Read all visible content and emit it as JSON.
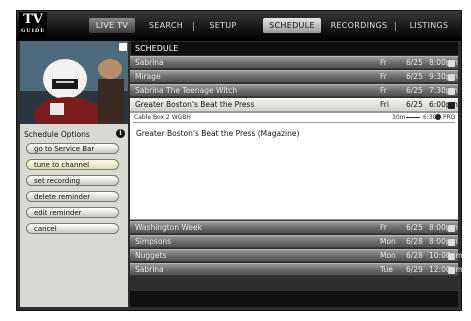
{
  "nav": {
    "live_tv": "LIVE TV",
    "search": "SEARCH",
    "setup": "SETUP",
    "schedule": "SCHEDULE",
    "recordings": "RECORDINGS",
    "listings": "LISTINGS"
  },
  "logo": {
    "main": "TV",
    "sub": "GUIDE"
  },
  "schedule_header": "SCHEDULE",
  "schedule_rows": [
    {
      "title": "Sabrina",
      "day": "Fr",
      "date": "6/25",
      "time": "8:00pm"
    },
    {
      "title": "Mirage",
      "day": "Fr",
      "date": "6/25",
      "time": "9:30pm"
    },
    {
      "title": "Sabrina The Teenage Witch",
      "day": "Fr",
      "date": "6/25",
      "time": "7:30pm"
    }
  ],
  "selected_row": {
    "title": "Greater Boston's Beat the Press",
    "day": "Fri",
    "date": "6/25",
    "time": "6:00pm"
  },
  "detail": {
    "subtitle": "Cable Box 2 WGBH",
    "duration": "30m",
    "end_time": "6:30",
    "rating": "PRO",
    "description": "Greater Boston's Beat the Press (Magazine)"
  },
  "schedule_rows_lower": [
    {
      "title": "Washington Week",
      "day": "Fr",
      "date": "6/25",
      "time": "8:00pm"
    },
    {
      "title": "Simpsons",
      "day": "Mon",
      "date": "6/28",
      "time": "8:00pm"
    },
    {
      "title": "Nuggets",
      "day": "Mon",
      "date": "6/28",
      "time": "10:00pm"
    },
    {
      "title": "Sabrina",
      "day": "Tue",
      "date": "6/29",
      "time": "12:00pm"
    }
  ],
  "options": {
    "title": "Schedule Options",
    "items": [
      "go to Service Bar",
      "tune to channel",
      "set recording",
      "delete reminder",
      "edit reminder",
      "cancel"
    ]
  },
  "colors": {
    "frame": "#2e2e2e",
    "panel": "#d9d9d3",
    "selected": "#f2f2ee"
  }
}
